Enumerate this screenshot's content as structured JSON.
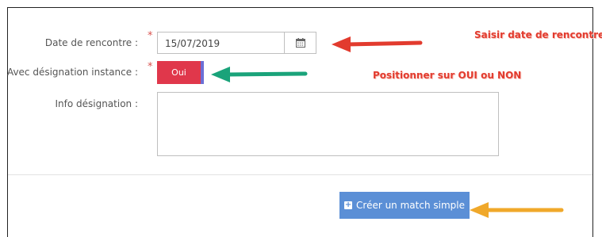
{
  "form": {
    "date_label": "Date de rencontre :",
    "date_value": "15/07/2019",
    "designation_label": "Avec désignation instance :",
    "toggle_value": "Oui",
    "info_label": "Info désignation :",
    "required_mark": "*",
    "calendar_icon": "calendar-icon"
  },
  "actions": {
    "create_label": "Créer un match simple",
    "create_icon": "plus-square-icon"
  },
  "annotations": {
    "date_note": "Saisir date de rencontre",
    "toggle_note": "Positionner sur OUI ou NON",
    "colors": {
      "red": "#e23b2e",
      "green": "#1aa37a",
      "orange": "#f0a82a"
    }
  },
  "colors": {
    "toggle": "#e0374b",
    "button": "#5b8fd6",
    "required": "#d9534f"
  }
}
